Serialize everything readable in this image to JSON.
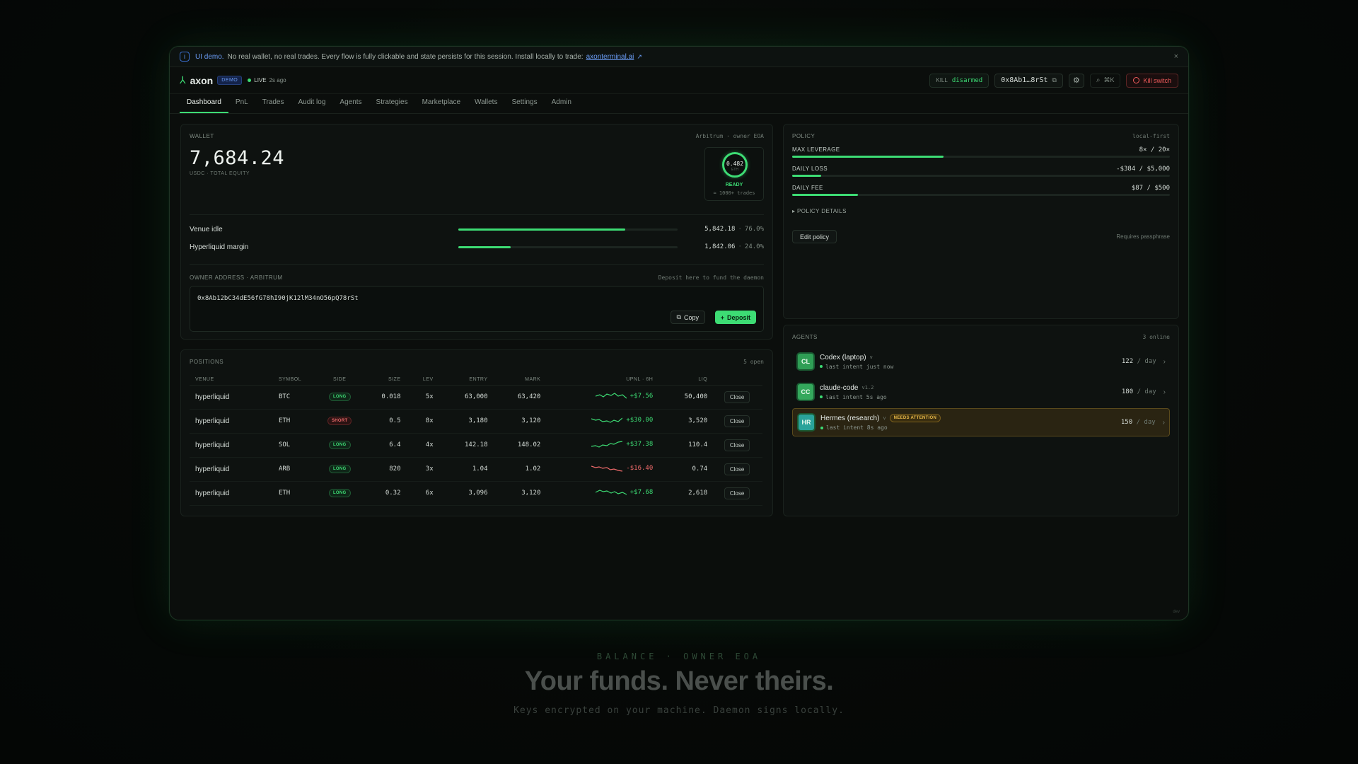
{
  "banner": {
    "strong": "UI demo.",
    "text": "No real wallet, no real trades. Every flow is fully clickable and state persists for this session. Install locally to trade:",
    "link": "axonterminal.ai",
    "close": "×"
  },
  "topbar": {
    "app_name": "axon",
    "demo_badge": "DEMO",
    "live_label": "LIVE",
    "live_age": "2s ago",
    "kill_label": "KILL",
    "kill_state": "disarmed",
    "address": "0x8Ab1…8rSt",
    "search_shortcut": "⌘K",
    "kill_switch": "Kill switch"
  },
  "tabs": [
    "Dashboard",
    "PnL",
    "Trades",
    "Audit log",
    "Agents",
    "Strategies",
    "Marketplace",
    "Wallets",
    "Settings",
    "Admin"
  ],
  "wallet": {
    "label": "WALLET",
    "meta": "Arbitrum · owner EOA",
    "balance": "7,684.24",
    "sub": "USDC · TOTAL EQUITY",
    "ready_value": "0.482",
    "ready_unit": "ETH",
    "ready_label": "READY",
    "ready_sub": "≈ 1000+ trades",
    "allocations": [
      {
        "name": "Venue idle",
        "value": "5,842.18",
        "pct": "76.0%",
        "fill": 0.76
      },
      {
        "name": "Hyperliquid margin",
        "value": "1,842.06",
        "pct": "24.0%",
        "fill": 0.24
      }
    ],
    "owner_label": "OWNER ADDRESS · ARBITRUM",
    "owner_hint": "Deposit here to fund the daemon",
    "owner_address": "0x8Ab12bC34dE56fG78hI90jK12lM34nO56pQ78rSt",
    "copy": "Copy",
    "deposit": "Deposit"
  },
  "positions": {
    "label": "POSITIONS",
    "count": "5 open",
    "columns": [
      "VENUE",
      "SYMBOL",
      "SIDE",
      "SIZE",
      "LEV",
      "ENTRY",
      "MARK",
      "UPNL · 6H",
      "LIQ",
      ""
    ],
    "rows": [
      {
        "venue": "hyperliquid",
        "symbol": "BTC",
        "side": "LONG",
        "size": "0.018",
        "lev": "5x",
        "entry": "63,000",
        "mark": "63,420",
        "upnl": "+$7.56",
        "liq": "50,400",
        "action": "Close"
      },
      {
        "venue": "hyperliquid",
        "symbol": "ETH",
        "side": "SHORT",
        "size": "0.5",
        "lev": "8x",
        "entry": "3,180",
        "mark": "3,120",
        "upnl": "+$30.00",
        "liq": "3,520",
        "action": "Close"
      },
      {
        "venue": "hyperliquid",
        "symbol": "SOL",
        "side": "LONG",
        "size": "6.4",
        "lev": "4x",
        "entry": "142.18",
        "mark": "148.02",
        "upnl": "+$37.38",
        "liq": "110.4",
        "action": "Close"
      },
      {
        "venue": "hyperliquid",
        "symbol": "ARB",
        "side": "LONG",
        "size": "820",
        "lev": "3x",
        "entry": "1.04",
        "mark": "1.02",
        "upnl": "-$16.40",
        "liq": "0.74",
        "action": "Close"
      },
      {
        "venue": "hyperliquid",
        "symbol": "ETH",
        "side": "LONG",
        "size": "0.32",
        "lev": "6x",
        "entry": "3,096",
        "mark": "3,120",
        "upnl": "+$7.68",
        "liq": "2,618",
        "action": "Close"
      }
    ]
  },
  "policy": {
    "label": "POLICY",
    "meta": "local-first",
    "rows": [
      {
        "name": "MAX LEVERAGE",
        "value": "8× / 20×",
        "fill": 0.4
      },
      {
        "name": "DAILY LOSS",
        "value": "-$384 / $5,000",
        "fill": 0.077
      },
      {
        "name": "DAILY FEE",
        "value": "$87 / $500",
        "fill": 0.174
      }
    ],
    "details": "POLICY DETAILS",
    "edit": "Edit policy",
    "requires": "Requires passphrase"
  },
  "agents": {
    "label": "AGENTS",
    "meta": "3 online",
    "items": [
      {
        "initials": "CL",
        "name": "Codex (laptop)",
        "version": "v",
        "badge": "",
        "last": "last intent just now",
        "rate": "122",
        "rate_unit": "/ day",
        "color": "#2f9e55"
      },
      {
        "initials": "CC",
        "name": "claude-code",
        "version": "v1.2",
        "badge": "",
        "last": "last intent 5s ago",
        "rate": "180",
        "rate_unit": "/ day",
        "color": "#34a85c"
      },
      {
        "initials": "HR",
        "name": "Hermes (research)",
        "version": "v",
        "badge": "NEEDS ATTENTION",
        "last": "last intent 8s ago",
        "rate": "150",
        "rate_unit": "/ day",
        "color": "#2aa39a"
      }
    ]
  },
  "dev_tag": "dev",
  "hero": {
    "kicker": "BALANCE · OWNER EOA",
    "title": "Your funds. Never theirs.",
    "subtitle": "Keys encrypted on your machine. Daemon signs locally."
  },
  "colors": {
    "accent": "#3ddc74",
    "danger": "#ef5b5b",
    "warning": "#e9b949",
    "info": "#6a9cf5"
  }
}
